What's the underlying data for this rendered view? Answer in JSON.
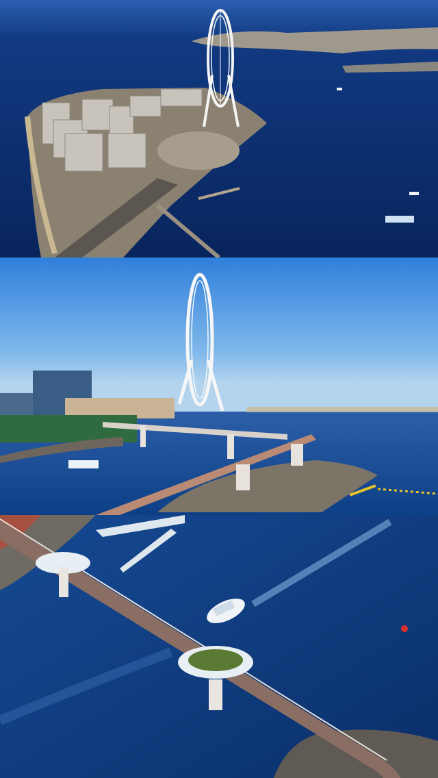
{
  "panels": [
    {
      "id": "aerial-island",
      "subject": "ferris-wheel-island-aerial"
    },
    {
      "id": "bridge-side",
      "subject": "ferris-wheel-bridge-side"
    },
    {
      "id": "bridge-top",
      "subject": "footbridge-top-down"
    }
  ],
  "colors": {
    "sea_deep": "#0b2a66",
    "sea_mid": "#1b4d9c",
    "sky": "#3f8ee6",
    "bridge": "#d9cfc4",
    "wheel": "#f2f2f2"
  }
}
